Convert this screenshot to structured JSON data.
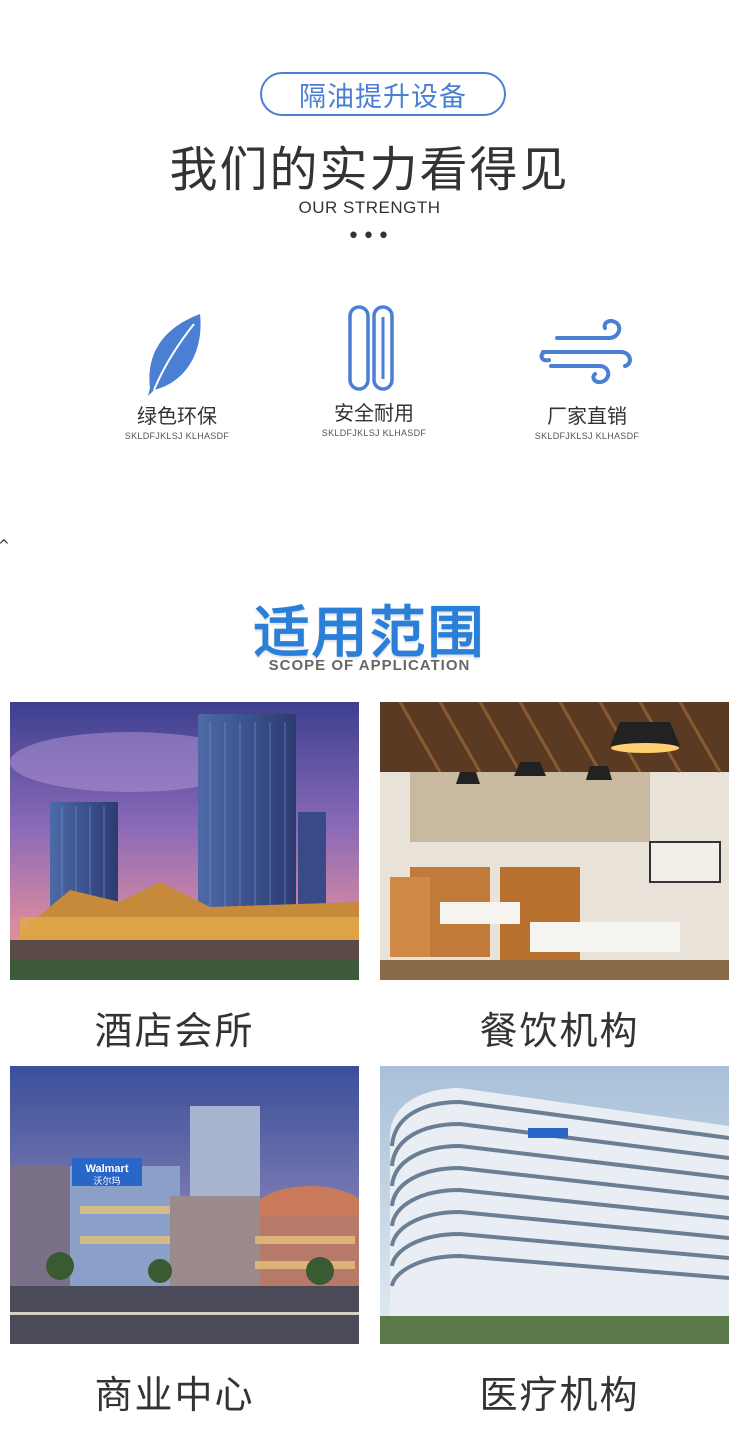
{
  "header": {
    "badge": "隔油提升设备",
    "title": "我们的实力看得见",
    "subtitle": "OUR STRENGTH",
    "dots": "•••"
  },
  "features": [
    {
      "title": "绿色环保",
      "sub": "SKLDFJKLSJ KLHASDF",
      "icon": "leaf-icon"
    },
    {
      "title": "安全耐用",
      "sub": "SKLDFJKLSJ KLHASDF",
      "icon": "pipes-icon"
    },
    {
      "title": "厂家直销",
      "sub": "SKLDFJKLSJ KLHASDF",
      "icon": "wind-icon"
    }
  ],
  "scope": {
    "title": "适用范围",
    "subtitle": "SCOPE OF APPLICATION"
  },
  "applications": [
    {
      "label": "酒店会所",
      "image": "hotel-towers-photo"
    },
    {
      "label": "餐饮机构",
      "image": "restaurant-interior-photo"
    },
    {
      "label": "商业中心",
      "image": "shopping-mall-photo",
      "sign": "Walmart",
      "sign_cn": "沃尔玛"
    },
    {
      "label": "医疗机构",
      "image": "hospital-building-photo"
    }
  ],
  "colors": {
    "accent": "#4a7fd4",
    "scope_title": "#2a7fd8"
  }
}
